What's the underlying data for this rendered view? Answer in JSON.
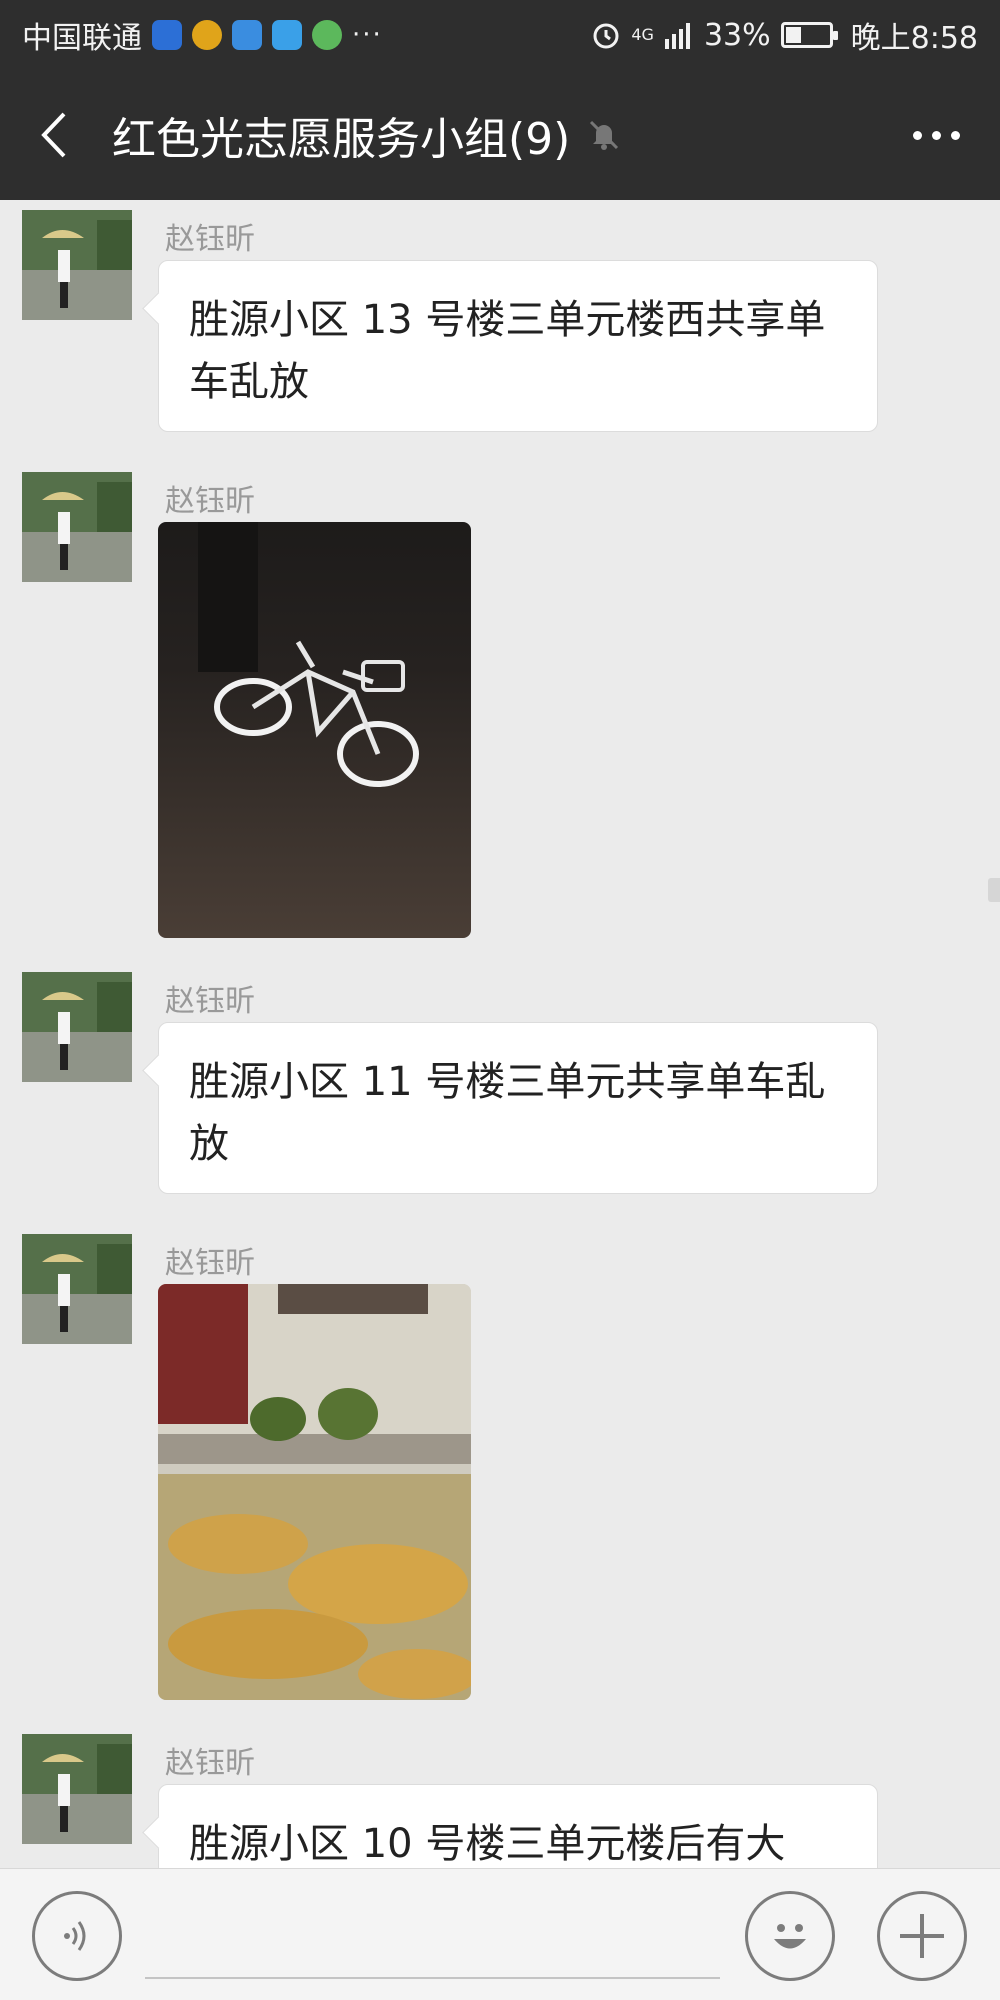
{
  "status_bar": {
    "carrier": "中国联通",
    "more": "···",
    "network": "4G",
    "battery": "33%",
    "time": "晚上8:58",
    "icon_colors": [
      "#2c6fd6",
      "#e0a41a",
      "#3a8de0",
      "#3aa0e8",
      "#5cb85c"
    ]
  },
  "nav": {
    "title": "红色光志愿服务小组(9)"
  },
  "messages": [
    {
      "sender": "赵钰昕",
      "type": "text",
      "text": "胜源小区 13 号楼三单元楼西共享单车乱放"
    },
    {
      "sender": "赵钰昕",
      "type": "image",
      "image": "bicycle-at-night-photo"
    },
    {
      "sender": "赵钰昕",
      "type": "text",
      "text": "胜源小区 11 号楼三单元共享单车乱放"
    },
    {
      "sender": "赵钰昕",
      "type": "image",
      "image": "fallen-leaves-photo"
    },
    {
      "sender": "赵钰昕",
      "type": "text",
      "text": "胜源小区 10 号楼三单元楼后有大"
    }
  ],
  "input_bar": {
    "voice_icon": "voice-icon",
    "emoji_icon": "emoji-icon",
    "add_icon": "plus-icon"
  }
}
